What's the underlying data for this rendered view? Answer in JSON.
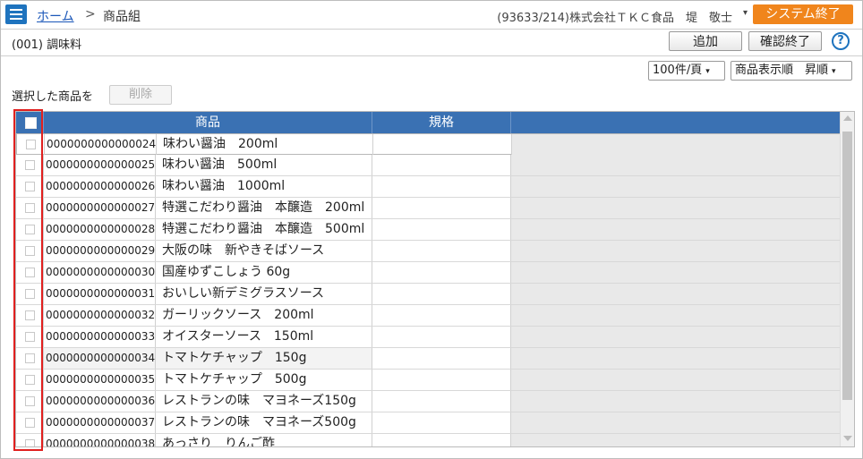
{
  "header": {
    "home_label": "ホーム",
    "separator": ">",
    "current": "商品組",
    "user_info": "(93633/214)株式会社ＴＫＣ食品　堤　敬士",
    "user_caret": "▾",
    "exit_label": "システム終了"
  },
  "subbar": {
    "group_title": "(001) 調味料",
    "add_label": "追加",
    "confirm_label": "確認終了",
    "help_label": "?"
  },
  "toolbar": {
    "per_page": "100件/頁",
    "sort": "商品表示順　昇順",
    "caret": "▾",
    "selected_label": "選択した商品を",
    "delete_label": "削除"
  },
  "grid": {
    "columns": [
      "商品",
      "規格"
    ],
    "rows": [
      {
        "code": "0000000000000024",
        "name": "味わい醤油　200ml",
        "spec": ""
      },
      {
        "code": "0000000000000025",
        "name": "味わい醤油　500ml",
        "spec": ""
      },
      {
        "code": "0000000000000026",
        "name": "味わい醤油　1000ml",
        "spec": ""
      },
      {
        "code": "0000000000000027",
        "name": "特選こだわり醤油　本醸造　200ml",
        "spec": ""
      },
      {
        "code": "0000000000000028",
        "name": "特選こだわり醤油　本醸造　500ml",
        "spec": ""
      },
      {
        "code": "0000000000000029",
        "name": "大阪の味　新やきそばソース",
        "spec": ""
      },
      {
        "code": "0000000000000030",
        "name": "国産ゆずこしょう 60g",
        "spec": ""
      },
      {
        "code": "0000000000000031",
        "name": "おいしい新デミグラスソース",
        "spec": ""
      },
      {
        "code": "0000000000000032",
        "name": "ガーリックソース　200ml",
        "spec": ""
      },
      {
        "code": "0000000000000033",
        "name": "オイスターソース　150ml",
        "spec": ""
      },
      {
        "code": "0000000000000034",
        "name": "トマトケチャップ　150g",
        "spec": ""
      },
      {
        "code": "0000000000000035",
        "name": "トマトケチャップ　500g",
        "spec": ""
      },
      {
        "code": "0000000000000036",
        "name": "レストランの味　マヨネーズ150g",
        "spec": ""
      },
      {
        "code": "0000000000000037",
        "name": "レストランの味　マヨネーズ500g",
        "spec": ""
      },
      {
        "code": "0000000000000038",
        "name": "あっさり　りんご酢",
        "spec": ""
      }
    ]
  },
  "colors": {
    "brand": "#1e73be",
    "header_bg": "#3a71b3",
    "exit_button": "#f0851c",
    "highlight": "#e0201f"
  }
}
